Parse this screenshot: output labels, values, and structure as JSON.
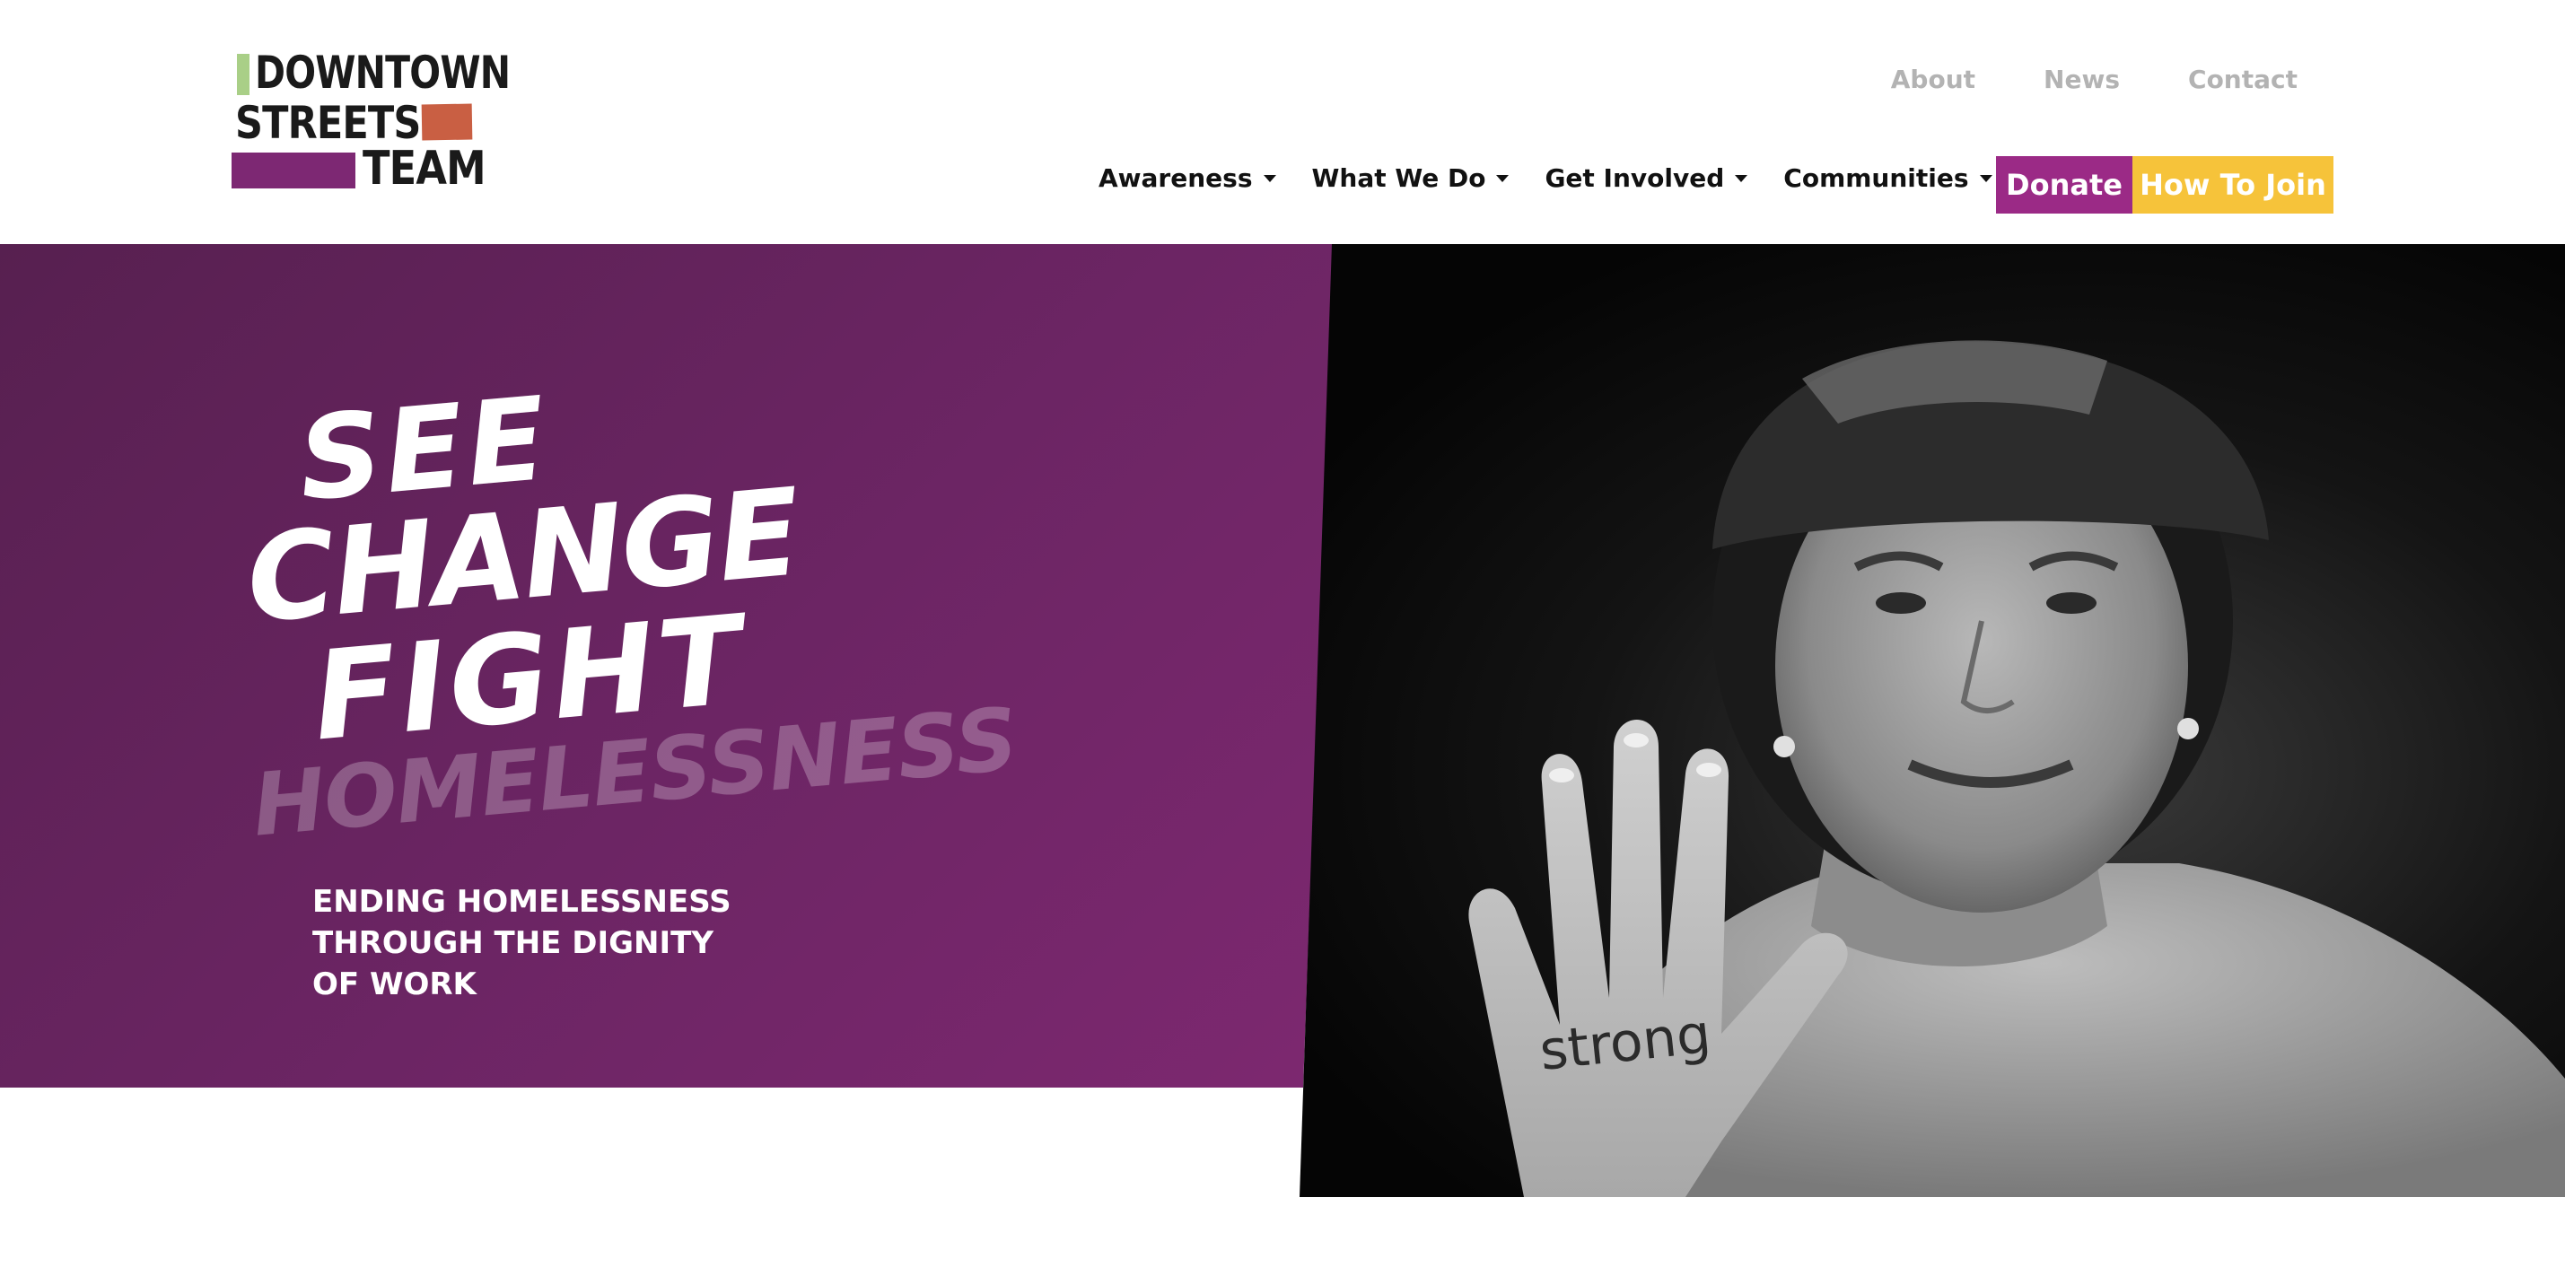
{
  "logo": {
    "line1": "DOWNTOWN",
    "line2": "STREETS",
    "line3": "TEAM",
    "colors": {
      "green": "#a9cf87",
      "orange": "#c95f43",
      "purple": "#7d2873"
    }
  },
  "utility_nav": [
    {
      "label": "About"
    },
    {
      "label": "News"
    },
    {
      "label": "Contact"
    }
  ],
  "main_nav": [
    {
      "label": "Awareness",
      "icon": "caret-down-icon"
    },
    {
      "label": "What We Do",
      "icon": "caret-down-icon"
    },
    {
      "label": "Get Involved",
      "icon": "caret-down-icon"
    },
    {
      "label": "Communities",
      "icon": "caret-down-icon"
    }
  ],
  "cta": {
    "donate_label": "Donate",
    "join_label": "How To Join",
    "colors": {
      "donate": "#9b2a86",
      "join": "#f6c33a"
    }
  },
  "hero": {
    "headline": {
      "line1": "SEE",
      "line2": "CHANGE",
      "line3": "FIGHT",
      "line4": "HOMELESSNESS"
    },
    "tagline_lines": [
      "ENDING HOMELESSNESS",
      "THROUGH THE DIGNITY",
      "OF WORK"
    ],
    "photo_hand_text": "strong",
    "colors": {
      "purple_dark": "#572050",
      "purple_light": "#7d2870"
    }
  }
}
